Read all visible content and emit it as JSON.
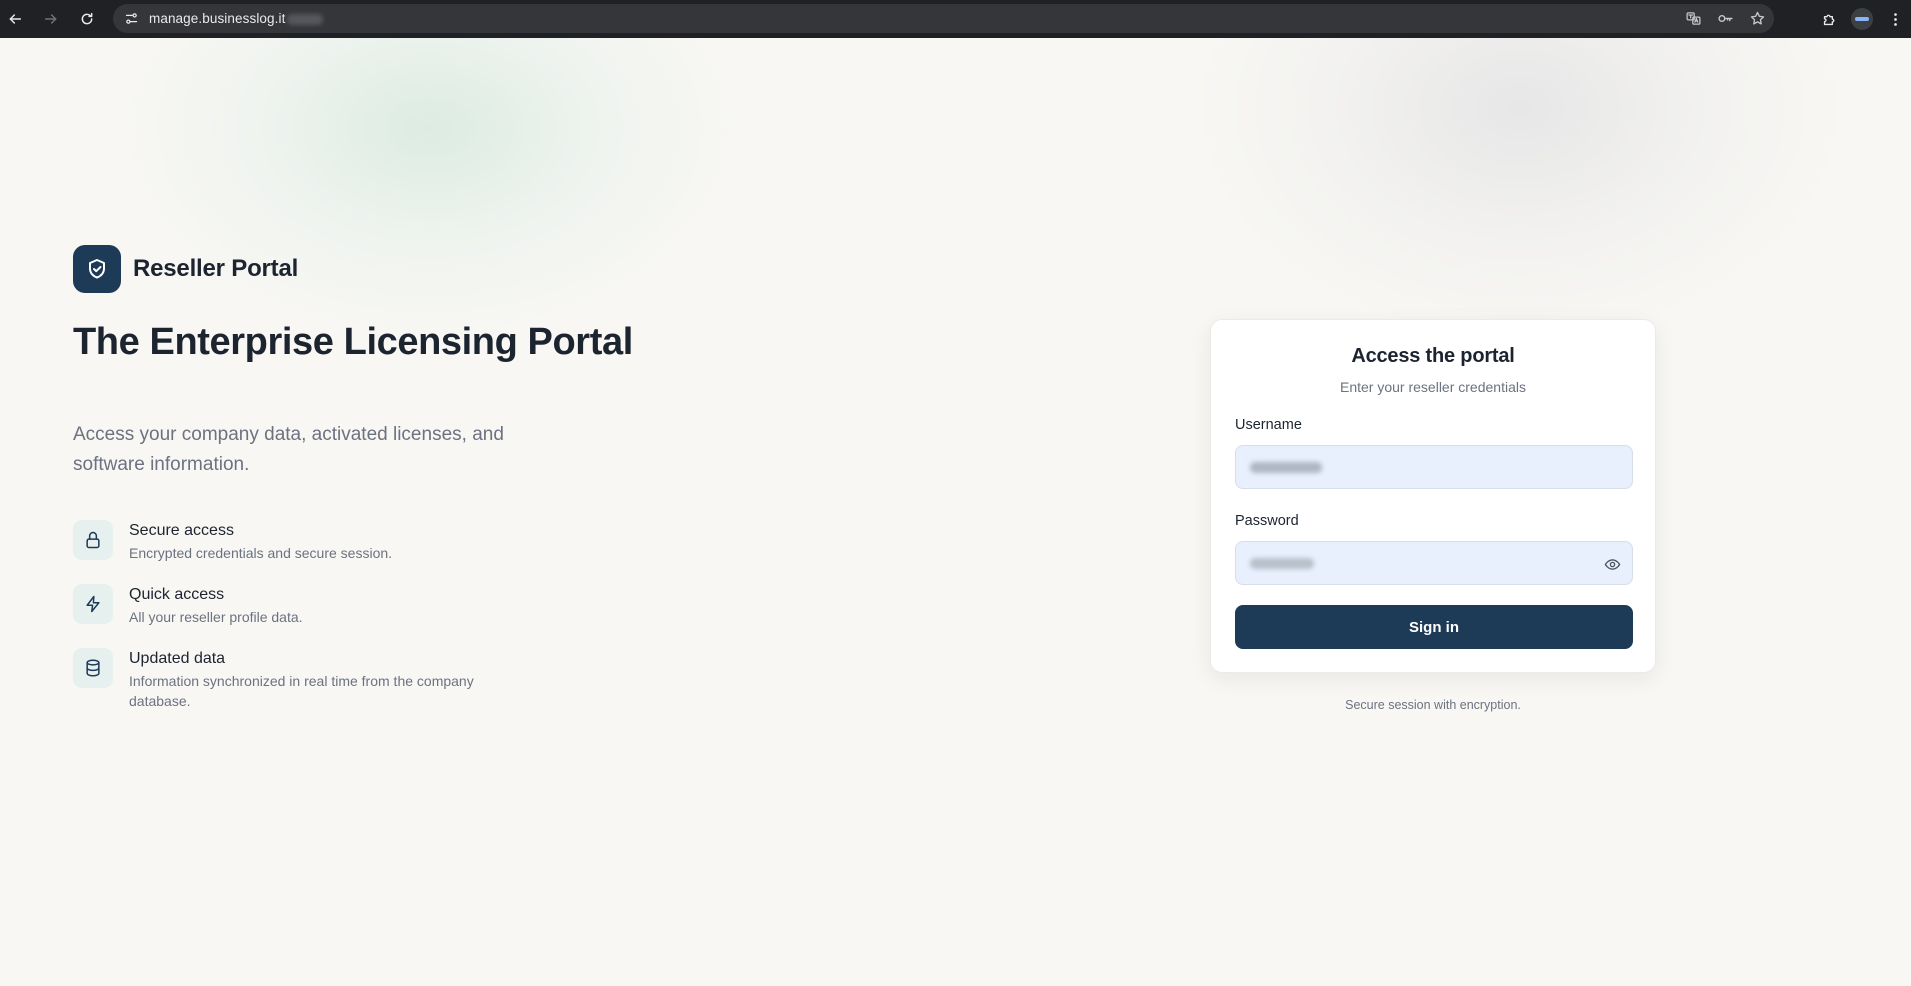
{
  "browser": {
    "url": "manage.businesslog.it",
    "icons": {
      "back": "arrow-left-icon",
      "forward": "arrow-right-icon",
      "reload": "reload-icon",
      "site_info": "tune-icon",
      "translate": "translate-icon",
      "passwords": "key-icon",
      "bookmark": "star-icon",
      "extensions": "puzzle-icon",
      "menu": "more-vert-icon"
    }
  },
  "brand": {
    "name": "Reseller Portal",
    "logo_icon": "shield-check-icon",
    "color": "#1d3a57"
  },
  "hero": {
    "title": "The Enterprise Licensing Portal",
    "subtitle": "Access your company data, activated licenses, and software information."
  },
  "features": [
    {
      "icon": "lock-icon",
      "title": "Secure access",
      "description": "Encrypted credentials and secure session."
    },
    {
      "icon": "lightning-icon",
      "title": "Quick access",
      "description": "All your reseller profile data."
    },
    {
      "icon": "database-icon",
      "title": "Updated data",
      "description": "Information synchronized in real time from the company database."
    }
  ],
  "login": {
    "title": "Access the portal",
    "subtitle": "Enter your reseller credentials",
    "username_label": "Username",
    "password_label": "Password",
    "submit_label": "Sign in",
    "footer_note": "Secure session with encryption."
  }
}
